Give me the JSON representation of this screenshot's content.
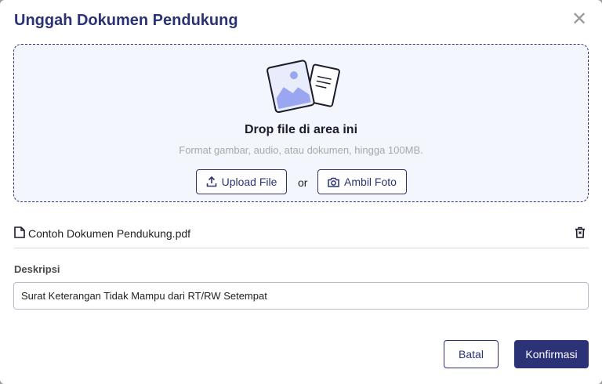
{
  "dialog": {
    "title": "Unggah Dokumen Pendukung",
    "close_icon": "close-icon"
  },
  "dropzone": {
    "title": "Drop file di area ini",
    "subtitle": "Format gambar, audio, atau dokumen, hingga 100MB.",
    "upload_label": "Upload File",
    "or_label": "or",
    "camera_label": "Ambil Foto",
    "icons": [
      "upload-icon",
      "camera-icon"
    ]
  },
  "file": {
    "name": "Contoh Dokumen Pendukung.pdf",
    "icons": [
      "document-icon",
      "trash-icon"
    ]
  },
  "description": {
    "label": "Deskripsi",
    "value": "Surat Keterangan Tidak Mampu dari RT/RW Setempat"
  },
  "footer": {
    "cancel_label": "Batal",
    "confirm_label": "Konfirmasi"
  },
  "colors": {
    "primary": "#2b3275",
    "dropzone_bg": "#f4f6fd",
    "muted_text": "#a8a8a8"
  }
}
